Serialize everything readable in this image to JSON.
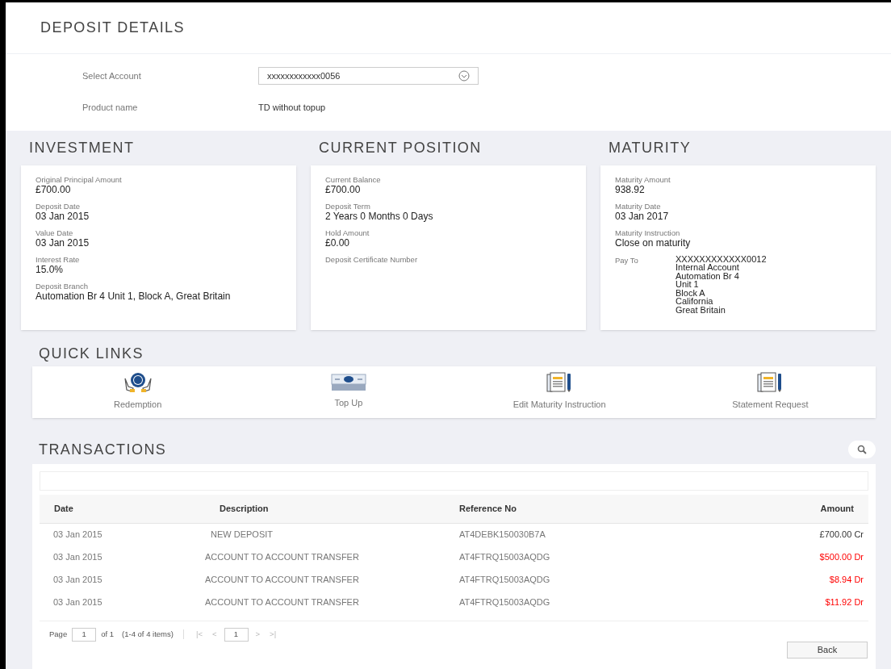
{
  "title": "DEPOSIT DETAILS",
  "account": {
    "label": "Select Account",
    "value": "xxxxxxxxxxxx0056"
  },
  "product": {
    "label": "Product name",
    "value": "TD without topup"
  },
  "sections": [
    {
      "title": "INVESTMENT",
      "fields": [
        {
          "label": "Original Principal Amount",
          "value": "£700.00"
        },
        {
          "label": "Deposit Date",
          "value": "03 Jan 2015"
        },
        {
          "label": "Value Date",
          "value": "03 Jan 2015"
        },
        {
          "label": "Interest Rate",
          "value": "15.0%"
        },
        {
          "label": "Deposit Branch",
          "value": "Automation Br 4 Unit 1, Block A, Great Britain"
        }
      ]
    },
    {
      "title": "CURRENT POSITION",
      "fields": [
        {
          "label": "Current Balance",
          "value": "£700.00"
        },
        {
          "label": "Deposit Term",
          "value": "2 Years 0 Months 0 Days"
        },
        {
          "label": "Hold Amount",
          "value": "£0.00"
        },
        {
          "label": "Deposit Certificate Number"
        }
      ]
    },
    {
      "title": "MATURITY",
      "fields": [
        {
          "label": "Maturity Amount",
          "value": "938.92"
        },
        {
          "label": "Maturity Date",
          "value": "03 Jan 2017"
        },
        {
          "label": "Maturity Instruction",
          "value": "Close on maturity"
        }
      ],
      "pay_to": {
        "label": "Pay To",
        "lines": [
          "XXXXXXXXXXXX0012",
          "Internal Account",
          "Automation Br 4",
          "Unit 1",
          "Block A",
          "California",
          "Great Britain"
        ]
      }
    }
  ],
  "quick_links": {
    "title": "QUICK LINKS",
    "items": [
      {
        "label": "Redemption",
        "kind": "hands"
      },
      {
        "label": "Top Up",
        "kind": "cash"
      },
      {
        "label": "Edit Maturity Instruction",
        "kind": "document"
      },
      {
        "label": "Statement Request",
        "kind": "document"
      }
    ]
  },
  "transactions": {
    "title": "TRANSACTIONS",
    "columns": [
      "Date",
      "Description",
      "Reference No",
      "Amount"
    ],
    "rows": [
      {
        "date": "03 Jan 2015",
        "description": "NEW DEPOSIT",
        "reference": "AT4DEBK150030B7A",
        "amount": "£700.00 Cr",
        "kind": "credit"
      },
      {
        "date": "03 Jan 2015",
        "description": "ACCOUNT TO ACCOUNT TRANSFER",
        "reference": "AT4FTRQ15003AQDG",
        "amount": "$500.00 Dr",
        "kind": "debit"
      },
      {
        "date": "03 Jan 2015",
        "description": "ACCOUNT TO ACCOUNT TRANSFER",
        "reference": "AT4FTRQ15003AQDG",
        "amount": "$8.94 Dr",
        "kind": "debit"
      },
      {
        "date": "03 Jan 2015",
        "description": "ACCOUNT TO ACCOUNT TRANSFER",
        "reference": "AT4FTRQ15003AQDG",
        "amount": "$11.92 Dr",
        "kind": "debit"
      }
    ],
    "pager": {
      "page_label": "Page",
      "page": "1",
      "of": "of 1",
      "items": "(1-4 of 4 items)",
      "first": "|<",
      "prev": "<",
      "current": "1",
      "next": ">",
      "last": ">|"
    }
  },
  "back_button": "Back"
}
